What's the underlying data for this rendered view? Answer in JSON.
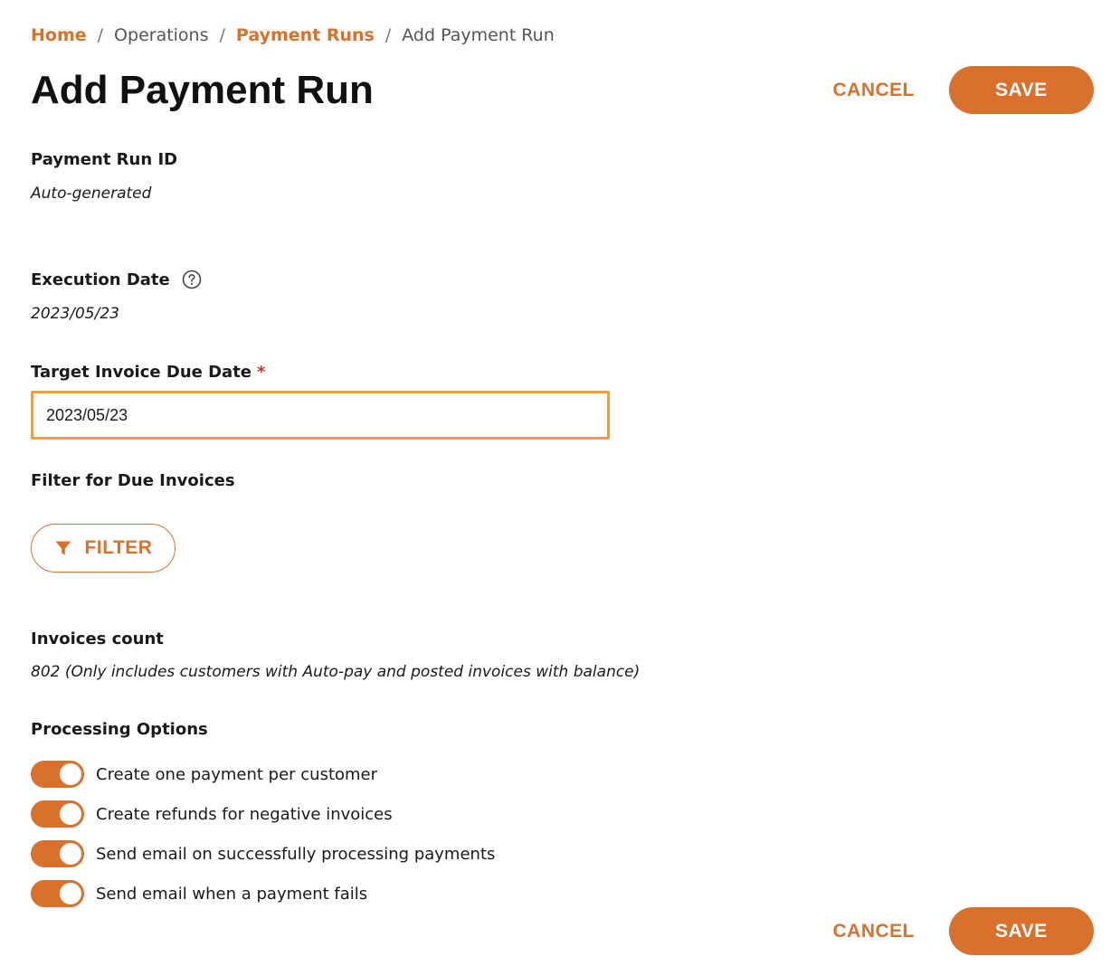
{
  "breadcrumb": {
    "home": "Home",
    "operations": "Operations",
    "payment_runs": "Payment Runs",
    "current": "Add Payment Run",
    "separator": "/"
  },
  "page": {
    "title": "Add Payment Run"
  },
  "actions": {
    "cancel_label": "CANCEL",
    "save_label": "SAVE"
  },
  "fields": {
    "payment_run_id": {
      "label": "Payment Run ID",
      "value": "Auto-generated"
    },
    "execution_date": {
      "label": "Execution Date",
      "value": "2023/05/23",
      "help_icon": "question-circle-icon"
    },
    "target_invoice_due_date": {
      "label": "Target Invoice Due Date",
      "required_mark": "*",
      "value": "2023/05/23"
    },
    "filter_due_invoices": {
      "label": "Filter for Due Invoices",
      "button_label": "FILTER",
      "button_icon": "funnel-icon"
    },
    "invoices_count": {
      "label": "Invoices count",
      "value": "802 (Only includes customers with Auto-pay and posted invoices with balance)"
    }
  },
  "processing_options": {
    "label": "Processing Options",
    "items": [
      {
        "label": "Create one payment per customer",
        "enabled": true
      },
      {
        "label": "Create refunds for negative invoices",
        "enabled": true
      },
      {
        "label": "Send email on successfully processing payments",
        "enabled": true
      },
      {
        "label": "Send email when a payment fails",
        "enabled": true
      }
    ]
  },
  "colors": {
    "accent": "#d9712c",
    "input_focus_border": "#e9a23b",
    "required": "#c0392b",
    "text": "#1a1a1a"
  }
}
